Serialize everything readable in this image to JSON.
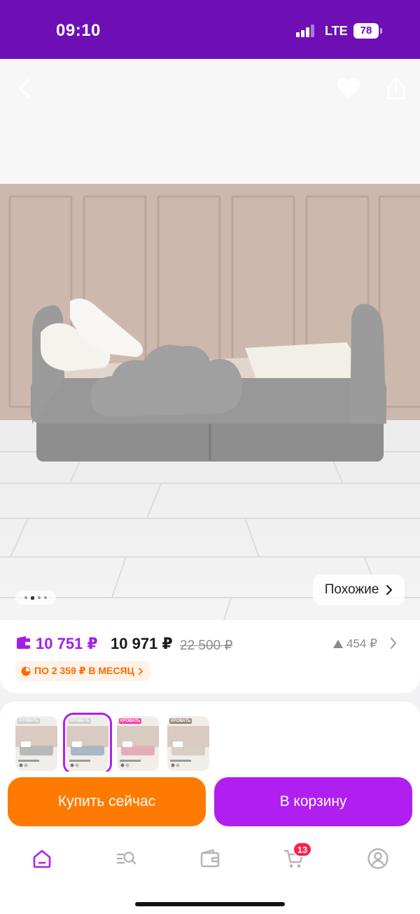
{
  "status_bar": {
    "time": "09:10",
    "network": "LTE",
    "battery": "78"
  },
  "gallery": {
    "similar_label": "Похожие",
    "dots_count": 4,
    "active_dot": 1
  },
  "price": {
    "wallet_price": "10 751 ₽",
    "price": "10 971 ₽",
    "old_price": "22 500 ₽",
    "price_drop": "454 ₽",
    "installment": "ПО 2 359 ₽ В МЕСЯЦ"
  },
  "variants": [
    {
      "label": "КРОВАТЬ",
      "tag_color": "#cfcfcf",
      "bed_color": "#b9b9b9",
      "selected": false
    },
    {
      "label": "КРОВАТЬ",
      "tag_color": "#cfcfcf",
      "bed_color": "#a9b8c4",
      "selected": true
    },
    {
      "label": "КРОВАТЬ",
      "tag_color": "#ff3fa0",
      "bed_color": "#e4aeb8",
      "selected": false
    },
    {
      "label": "КРОВАТЬ",
      "tag_color": "#9b8c7a",
      "bed_color": "#d8cfc4",
      "selected": false
    }
  ],
  "actions": {
    "buy_now": "Купить сейчас",
    "add_to_cart": "В корзину"
  },
  "tabbar": {
    "items": [
      "home-icon",
      "catalog-search-icon",
      "wallet-icon",
      "cart-icon",
      "profile-icon"
    ],
    "active": "home-icon",
    "cart_count": "13"
  },
  "colors": {
    "brand_purple": "#6e0fb5",
    "accent_purple": "#b01ff0",
    "accent_orange": "#ff7a00",
    "badge_red": "#ff1f4b"
  }
}
